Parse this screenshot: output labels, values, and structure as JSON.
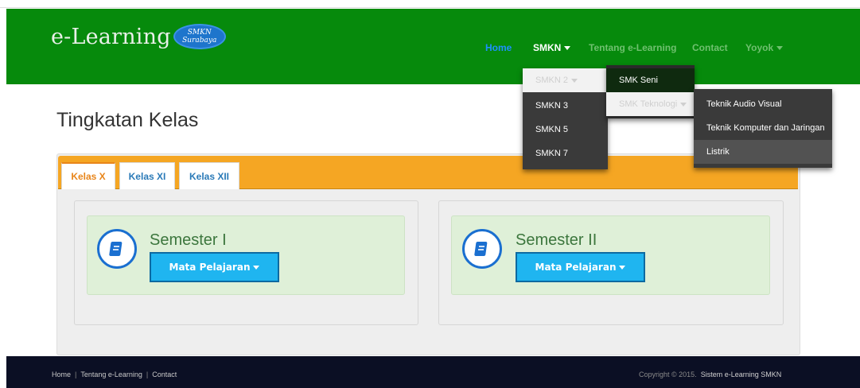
{
  "header": {
    "brand_text": "e-Learning",
    "badge_line1": "SMKN",
    "badge_line2": "Surabaya",
    "nav": {
      "home": "Home",
      "smkn": "SMKN",
      "tentang": "Tentang e-Learning",
      "contact": "Contact",
      "user": "Yoyok"
    }
  },
  "dropdown_smkn": {
    "items": [
      "SMKN 2",
      "SMKN 3",
      "SMKN 5",
      "SMKN 7"
    ]
  },
  "dropdown_smkn2": {
    "items": [
      "SMK Seni",
      "SMK Teknologi"
    ]
  },
  "dropdown_teknologi": {
    "items": [
      "Teknik Audio Visual",
      "Teknik Komputer dan Jaringan",
      "Listrik"
    ]
  },
  "main": {
    "title": "Tingkatan Kelas",
    "tabs": [
      "Kelas X",
      "Kelas XI",
      "Kelas XII"
    ],
    "active_tab": "Kelas X",
    "semesters": [
      {
        "title": "Semester I",
        "button": "Mata Pelajaran"
      },
      {
        "title": "Semester II",
        "button": "Mata Pelajaran"
      }
    ]
  },
  "footer": {
    "links": [
      "Home",
      "Tentang e-Learning",
      "Contact"
    ],
    "copyright": "Copyright © 2015.",
    "system": "Sistem e-Learning SMKN"
  },
  "colors": {
    "navbar": "#068a0c",
    "tabbar": "#f5a623",
    "button": "#1fb5f0",
    "footer": "#0b0f24"
  },
  "icons": {
    "semester": "book-icon"
  }
}
